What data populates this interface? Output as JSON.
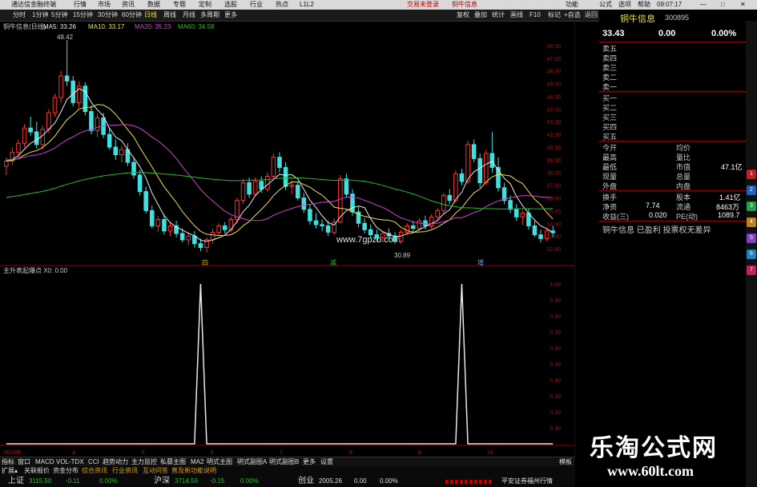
{
  "topbar": {
    "app_title": "通达信金融终端",
    "menus": [
      "行情",
      "市场",
      "资讯",
      "数据",
      "专题",
      "定制",
      "选股",
      "行业",
      "热点",
      "L1L2"
    ],
    "trade_notice": "交易未登录",
    "stock_name": "铜牛信息",
    "right_menus": [
      "功能",
      "公式",
      "选项",
      "帮助"
    ],
    "time": "09:07:17"
  },
  "periods": [
    "分时",
    "1分钟",
    "5分钟",
    "15分钟",
    "30分钟",
    "60分钟",
    "日线",
    "周线",
    "月线",
    "多周期",
    "更多"
  ],
  "toolbar_right": [
    "复权",
    "叠加",
    "统计",
    "画线",
    "F10",
    "标记",
    "+自选",
    "返回"
  ],
  "main_chart": {
    "title": "铜牛信息(日线)",
    "ma_labels": [
      {
        "text": "MA5: 33.26",
        "color": "#e8e8e8"
      },
      {
        "text": "MA10: 33.17",
        "color": "#f0e040"
      },
      {
        "text": "MA20: 35.23",
        "color": "#d040d0"
      },
      {
        "text": "MA60: 34.58",
        "color": "#20c020"
      }
    ],
    "high_label": "48.42",
    "low_label": "30.89",
    "watermark": "www.7gpzb.com",
    "price_ticks": [
      "48.00",
      "47.00",
      "46.00",
      "45.00",
      "44.00",
      "43.00",
      "42.00",
      "41.00",
      "40.00",
      "39.00",
      "38.00",
      "37.00",
      "36.00",
      "35.00",
      "34.00",
      "33.00",
      "32.00"
    ],
    "markers": [
      "四",
      "减",
      "增"
    ]
  },
  "chart_data": [
    {
      "type": "candlestick",
      "title": "铜牛信息(日线)",
      "ylim": [
        31.5,
        49
      ],
      "candles": [
        [
          38.5,
          39.2,
          37.8,
          38.9
        ],
        [
          38.9,
          40,
          38.6,
          39.6
        ],
        [
          39.6,
          40.6,
          39.2,
          40.3
        ],
        [
          40.3,
          41.8,
          40,
          41.5
        ],
        [
          41.5,
          42.4,
          40.9,
          41.2
        ],
        [
          41.2,
          42,
          39.9,
          40.2
        ],
        [
          40.2,
          41.7,
          39.8,
          41.4
        ],
        [
          41.4,
          43,
          41.1,
          42.7
        ],
        [
          42.7,
          44.2,
          42.4,
          43.9
        ],
        [
          43.9,
          46,
          43.5,
          45.6
        ],
        [
          45.6,
          48.42,
          44.8,
          45.2
        ],
        [
          45.2,
          45.6,
          43.2,
          43.5
        ],
        [
          43.5,
          45.2,
          43.1,
          44.8
        ],
        [
          44.8,
          45.1,
          42.5,
          42.8
        ],
        [
          42.8,
          43.3,
          41,
          41.3
        ],
        [
          41.3,
          42.6,
          40.8,
          42.3
        ],
        [
          42.3,
          42.7,
          40.7,
          41
        ],
        [
          41,
          41.5,
          39.8,
          40
        ],
        [
          40,
          40.6,
          39,
          39.4
        ],
        [
          39.4,
          40.1,
          38.8,
          39.8
        ],
        [
          39.8,
          40.3,
          38.5,
          38.8
        ],
        [
          38.8,
          39.2,
          37.5,
          37.8
        ],
        [
          37.8,
          38.2,
          36.2,
          36.5
        ],
        [
          36.5,
          36.9,
          34.8,
          35
        ],
        [
          35,
          35.4,
          33.6,
          33.8
        ],
        [
          33.8,
          34.6,
          33.3,
          34.3
        ],
        [
          34.3,
          34.7,
          33.1,
          33.4
        ],
        [
          33.4,
          34.1,
          33,
          33.8
        ],
        [
          33.8,
          34.2,
          32.9,
          33.2
        ],
        [
          33.2,
          33.6,
          32.5,
          32.7
        ],
        [
          32.7,
          33.3,
          32.3,
          33
        ],
        [
          33,
          33.4,
          32.1,
          32.4
        ],
        [
          32.4,
          32.8,
          31.8,
          32.1
        ],
        [
          32.1,
          32.9,
          31.7,
          32.7
        ],
        [
          32.7,
          33.6,
          32.4,
          33.3
        ],
        [
          33.3,
          34,
          33,
          33.8
        ],
        [
          33.8,
          34.1,
          33.2,
          33.5
        ],
        [
          33.5,
          34.5,
          33.3,
          34.3
        ],
        [
          34.3,
          36,
          34,
          35.8
        ],
        [
          35.8,
          37.5,
          35.5,
          37.2
        ],
        [
          37.2,
          37.6,
          36,
          36.3
        ],
        [
          36.3,
          37.6,
          36.1,
          37.3
        ],
        [
          37.3,
          37.7,
          36.4,
          36.7
        ],
        [
          36.7,
          38,
          36.5,
          37.7
        ],
        [
          37.7,
          39.5,
          37.5,
          39.2
        ],
        [
          39.2,
          39.6,
          38,
          38.4
        ],
        [
          38.4,
          38.8,
          36.6,
          36.9
        ],
        [
          36.9,
          37.4,
          36.3,
          37
        ],
        [
          37,
          37.3,
          35.8,
          36
        ],
        [
          36,
          36.4,
          34.8,
          35.1
        ],
        [
          35.1,
          35.5,
          33.9,
          34.2
        ],
        [
          34.2,
          34.8,
          33.6,
          33.9
        ],
        [
          33.9,
          34.3,
          33.4,
          33.8
        ],
        [
          33.8,
          34.2,
          33,
          33.3
        ],
        [
          33.3,
          34.4,
          33.1,
          34.1
        ],
        [
          34.1,
          37.8,
          34,
          37.5
        ],
        [
          37.5,
          37.9,
          36,
          36.3
        ],
        [
          36.3,
          36.7,
          34.6,
          34.9
        ],
        [
          34.9,
          35.3,
          33.7,
          34
        ],
        [
          34,
          34.4,
          33.2,
          33.5
        ],
        [
          33.5,
          33.9,
          32.8,
          33.1
        ],
        [
          33.1,
          33.5,
          32.6,
          32.9
        ],
        [
          32.9,
          33.4,
          32.5,
          33.2
        ],
        [
          33.2,
          33.6,
          32.7,
          33
        ],
        [
          33,
          33.3,
          32.4,
          32.6
        ],
        [
          32.6,
          33.5,
          32.4,
          33.3
        ],
        [
          33.3,
          34,
          33.1,
          33.8
        ],
        [
          33.8,
          34.2,
          33.3,
          33.6
        ],
        [
          33.6,
          34.4,
          33.4,
          34.2
        ],
        [
          34.2,
          34.6,
          33.5,
          33.8
        ],
        [
          33.8,
          34.7,
          33.6,
          34.5
        ],
        [
          34.5,
          35.2,
          34.2,
          35
        ],
        [
          35,
          36.4,
          34.8,
          36.2
        ],
        [
          36.2,
          36.7,
          35.5,
          35.8
        ],
        [
          35.8,
          38.2,
          35.6,
          37.9
        ],
        [
          37.9,
          38.3,
          37,
          37.3
        ],
        [
          37.3,
          40.5,
          37.1,
          40.2
        ],
        [
          40.2,
          40.6,
          38.8,
          39.1
        ],
        [
          39.1,
          39.5,
          36.8,
          37.2
        ],
        [
          37.2,
          39.8,
          37,
          39.5
        ],
        [
          39.5,
          41.2,
          38,
          38.4
        ],
        [
          38.4,
          39.2,
          36.5,
          36.8
        ],
        [
          36.8,
          37.2,
          35.5,
          35.8
        ],
        [
          35.8,
          36.2,
          34.8,
          35.1
        ],
        [
          35.1,
          35.5,
          34.2,
          34.5
        ],
        [
          34.5,
          35,
          33.9,
          34.8
        ],
        [
          34.8,
          35.2,
          33.5,
          33.8
        ],
        [
          33.8,
          34.2,
          32.9,
          33.1
        ],
        [
          33.1,
          33.5,
          32.5,
          32.8
        ],
        [
          32.8,
          33.6,
          32.6,
          33.4
        ],
        [
          33.4,
          33.8,
          32.9,
          33.26
        ]
      ]
    },
    {
      "type": "line",
      "title": "主升表起爆点 X0: 0.00",
      "ylim": [
        0,
        1.05
      ],
      "y_ticks": [
        "1.00",
        "0.90",
        "0.80",
        "0.70",
        "0.60",
        "0.50",
        "0.40",
        "0.30",
        "0.20",
        "0.10"
      ],
      "spikes_at_index": [
        32,
        75
      ],
      "spike_value": 1.0,
      "x_labels": [
        "2023年",
        "4",
        "5",
        "6",
        "7",
        "8",
        "9",
        "10"
      ]
    }
  ],
  "indicator_panel": {
    "title": "主升表起爆点 X0: 0.00"
  },
  "indicator_tabs": [
    "指标",
    "窗口",
    "MACD",
    "VOL-TDX",
    "CCI",
    "趋势动力",
    "主力监控",
    "私募主图",
    "MA2",
    "明式主图",
    "明式副图A",
    "明式副图B",
    "更多",
    "设置",
    "模板"
  ],
  "bottom_tabs": [
    "扩展▴",
    "关联报价",
    "资金分布",
    "综合资讯",
    "行业资讯",
    "互动问答",
    "普及新功能说明"
  ],
  "indices": [
    {
      "name": "上证",
      "value": "3115.50",
      "change": "-0.11",
      "pct": "0.00%"
    },
    {
      "name": "沪深",
      "value": "3714.59",
      "change": "-0.15",
      "pct": "0.00%"
    },
    {
      "name": "创业",
      "value": "2005.26",
      "change": "0.00",
      "pct": "0.00%"
    }
  ],
  "status_right": "平安证券福州行情",
  "quote": {
    "name": "铜牛信息",
    "code": "300895",
    "price": "33.43",
    "change": "0.00",
    "pct": "0.00%",
    "order_book": [
      "卖五",
      "卖四",
      "卖三",
      "卖二",
      "卖一",
      "买一",
      "买二",
      "买三",
      "买四",
      "买五"
    ],
    "left_labels": [
      "今开",
      "最高",
      "最低",
      "现量",
      "外盘"
    ],
    "right_labels": [
      "均价",
      "量比",
      "市值",
      "总量",
      "内盘"
    ],
    "market_value": "47.1亿",
    "ratio_rows": [
      {
        "l": "换手",
        "r": "股本",
        "v": "1.41亿"
      },
      {
        "l": "净资",
        "lv": "7.74",
        "r": "流通",
        "v": "8463万"
      },
      {
        "l": "收益(三)",
        "lv": "0.020",
        "r": "PE(动)",
        "v": "1089.7"
      }
    ],
    "footer": "铜牛信息 已盈利 投票权无差异"
  },
  "brand": {
    "name": "乐淘公式网",
    "url": "www.60lt.com"
  }
}
